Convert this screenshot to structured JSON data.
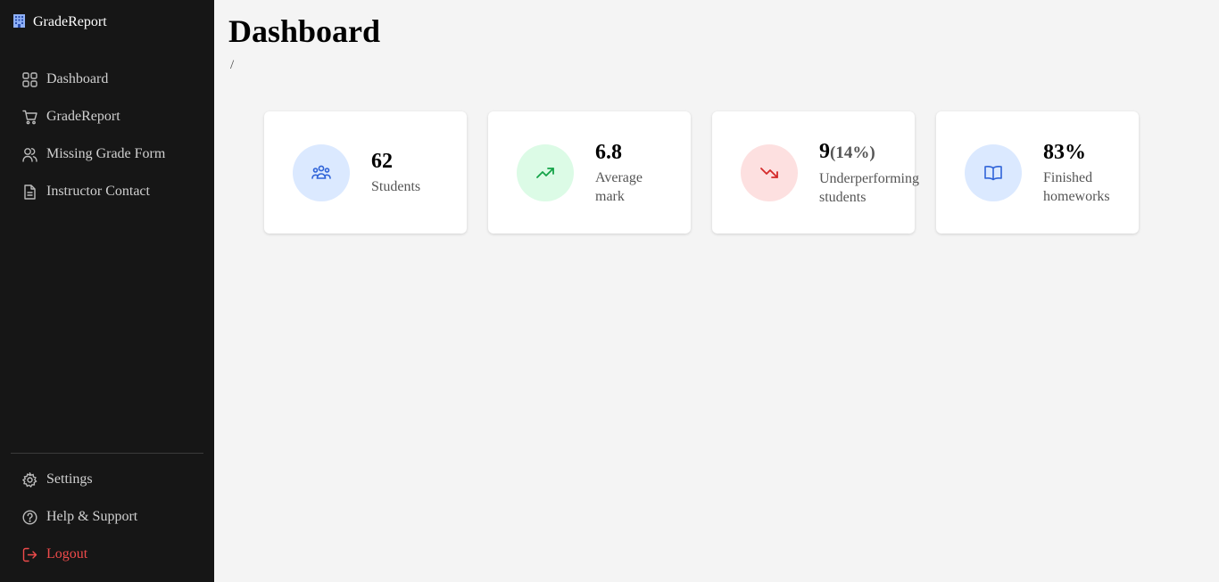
{
  "brand": {
    "name": "GradeReport"
  },
  "sidebar": {
    "items": [
      {
        "label": "Dashboard",
        "icon": "grid-icon"
      },
      {
        "label": "GradeReport",
        "icon": "cart-icon"
      },
      {
        "label": "Missing Grade Form",
        "icon": "users-icon"
      },
      {
        "label": "Instructor Contact",
        "icon": "document-icon"
      }
    ],
    "bottom": [
      {
        "label": "Settings",
        "icon": "gear-icon"
      },
      {
        "label": "Help & Support",
        "icon": "help-icon"
      },
      {
        "label": "Logout",
        "icon": "logout-icon"
      }
    ]
  },
  "page": {
    "title": "Dashboard",
    "breadcrumb": "/"
  },
  "cards": [
    {
      "value": "62",
      "sub": "",
      "label": "Students",
      "icon": "users-group-icon",
      "bg": "#dbe9ff",
      "fg": "#2f63d8"
    },
    {
      "value": "6.8",
      "sub": "",
      "label": "Average\nmark",
      "icon": "trending-up-icon",
      "bg": "#dcfbe6",
      "fg": "#15a348"
    },
    {
      "value": "9",
      "sub": "(14%)",
      "label": "Underperforming\nstudents",
      "icon": "trending-down-icon",
      "bg": "#fde0e0",
      "fg": "#d42a2a"
    },
    {
      "value": "83%",
      "sub": "",
      "label": "Finished\nhomeworks",
      "icon": "book-open-icon",
      "bg": "#dbe9ff",
      "fg": "#2f63d8"
    }
  ]
}
